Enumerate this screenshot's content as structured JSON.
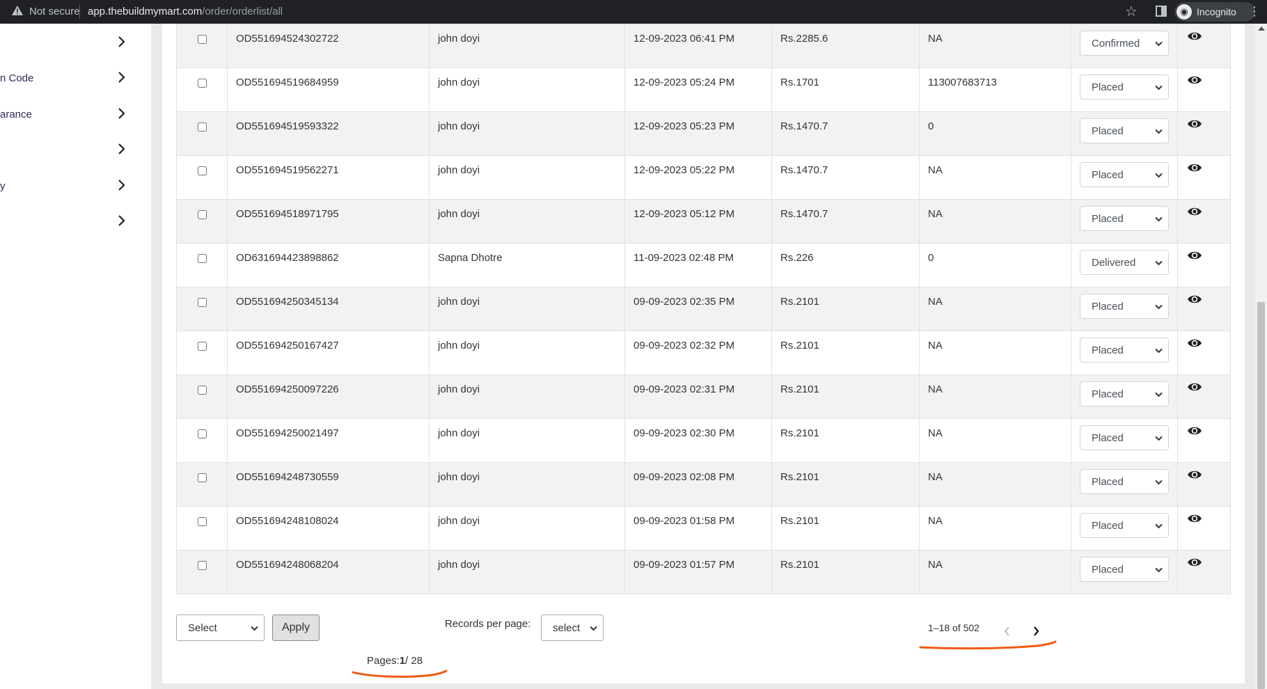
{
  "browser": {
    "security_label": "Not secure",
    "url_domain": "app.thebuildmymart.com",
    "url_path": "/order/orderlist/all",
    "profile_label": "Incognito"
  },
  "sidebar": {
    "items": [
      {
        "label": ""
      },
      {
        "label": "n Code"
      },
      {
        "label": "arance"
      },
      {
        "label": ""
      },
      {
        "label": "y"
      },
      {
        "label": ""
      }
    ]
  },
  "orders": {
    "rows": [
      {
        "order_id": "OD551694524302722",
        "customer": "john doyi",
        "date": "12-09-2023 06:41 PM",
        "amount": "Rs.2285.6",
        "tracking": "NA",
        "status": "Confirmed"
      },
      {
        "order_id": "OD551694519684959",
        "customer": "john doyi",
        "date": "12-09-2023 05:24 PM",
        "amount": "Rs.1701",
        "tracking": "113007683713",
        "status": "Placed"
      },
      {
        "order_id": "OD551694519593322",
        "customer": "john doyi",
        "date": "12-09-2023 05:23 PM",
        "amount": "Rs.1470.7",
        "tracking": "0",
        "status": "Placed"
      },
      {
        "order_id": "OD551694519562271",
        "customer": "john doyi",
        "date": "12-09-2023 05:22 PM",
        "amount": "Rs.1470.7",
        "tracking": "NA",
        "status": "Placed"
      },
      {
        "order_id": "OD551694518971795",
        "customer": "john doyi",
        "date": "12-09-2023 05:12 PM",
        "amount": "Rs.1470.7",
        "tracking": "NA",
        "status": "Placed"
      },
      {
        "order_id": "OD631694423898862",
        "customer": "Sapna Dhotre",
        "date": "11-09-2023 02:48 PM",
        "amount": "Rs.226",
        "tracking": "0",
        "status": "Delivered"
      },
      {
        "order_id": "OD551694250345134",
        "customer": "john doyi",
        "date": "09-09-2023 02:35 PM",
        "amount": "Rs.2101",
        "tracking": "NA",
        "status": "Placed"
      },
      {
        "order_id": "OD551694250167427",
        "customer": "john doyi",
        "date": "09-09-2023 02:32 PM",
        "amount": "Rs.2101",
        "tracking": "NA",
        "status": "Placed"
      },
      {
        "order_id": "OD551694250097226",
        "customer": "john doyi",
        "date": "09-09-2023 02:31 PM",
        "amount": "Rs.2101",
        "tracking": "NA",
        "status": "Placed"
      },
      {
        "order_id": "OD551694250021497",
        "customer": "john doyi",
        "date": "09-09-2023 02:30 PM",
        "amount": "Rs.2101",
        "tracking": "NA",
        "status": "Placed"
      },
      {
        "order_id": "OD551694248730559",
        "customer": "john doyi",
        "date": "09-09-2023 02:08 PM",
        "amount": "Rs.2101",
        "tracking": "NA",
        "status": "Placed"
      },
      {
        "order_id": "OD551694248108024",
        "customer": "john doyi",
        "date": "09-09-2023 01:58 PM",
        "amount": "Rs.2101",
        "tracking": "NA",
        "status": "Placed"
      },
      {
        "order_id": "OD551694248068204",
        "customer": "john doyi",
        "date": "09-09-2023 01:57 PM",
        "amount": "Rs.2101",
        "tracking": "NA",
        "status": "Placed"
      }
    ]
  },
  "footer": {
    "bulk_select_value": "Select",
    "apply_label": "Apply",
    "records_per_page_label": "Records per page:",
    "records_per_page_value": "select",
    "range_text": "1–18 of 502",
    "pages_prefix": "Pages:",
    "pages_current": "1",
    "pages_total": "/ 28"
  },
  "colors": {
    "annotation": "#f05a13",
    "sidebar_text": "#2c2c58"
  }
}
